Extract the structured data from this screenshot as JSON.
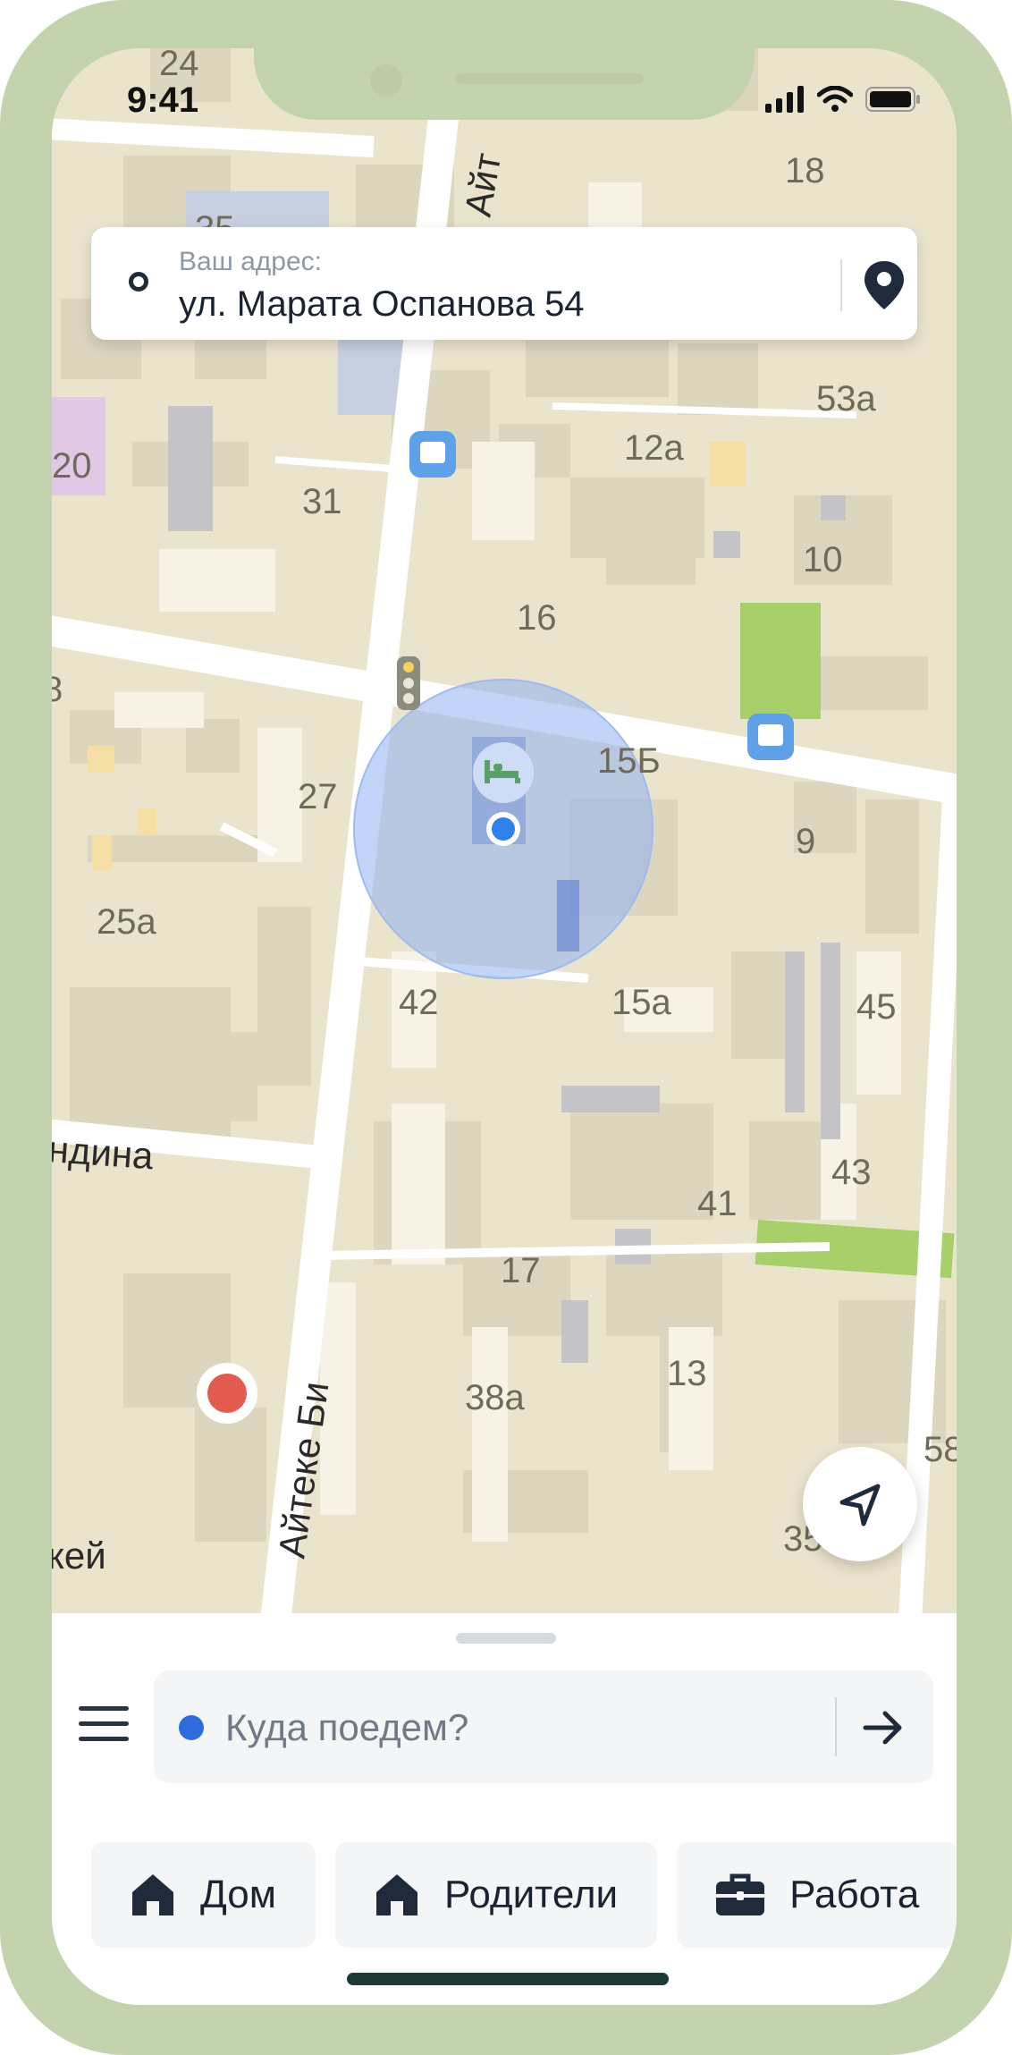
{
  "status": {
    "time": "9:41"
  },
  "address_card": {
    "label": "Ваш адрес:",
    "value": "ул. Марата Оспанова 54"
  },
  "map": {
    "house_numbers": [
      "24",
      "18",
      "35",
      "53а",
      "20",
      "31",
      "12а",
      "10",
      "16",
      "8",
      "15Б",
      "27",
      "9",
      "25а",
      "42",
      "15а",
      "45",
      "43",
      "41",
      "17",
      "13",
      "38а",
      "58",
      "35"
    ],
    "street_labels": [
      "Айт",
      "ндина",
      "Айтеке Би",
      "кей"
    ]
  },
  "search": {
    "placeholder": "Куда поедем?"
  },
  "quick_places": [
    {
      "label": "Дом",
      "icon": "home-icon"
    },
    {
      "label": "Родители",
      "icon": "home-icon"
    },
    {
      "label": "Работа",
      "icon": "briefcase-icon"
    }
  ],
  "colors": {
    "frame": "#c3d3ad",
    "accent_blue": "#2f6bdb",
    "map_bg": "#ebe4cd",
    "dark_text": "#1b2330"
  }
}
